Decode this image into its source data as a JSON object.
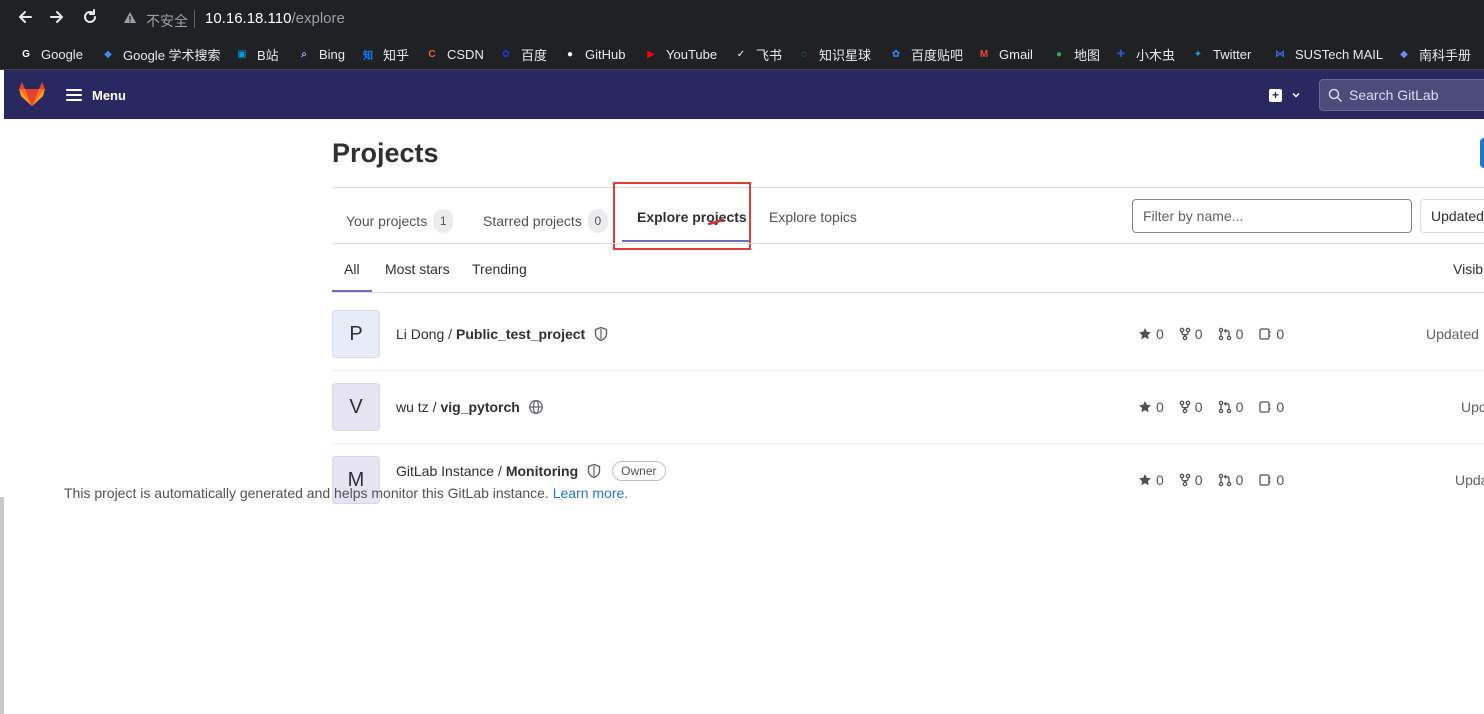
{
  "browser": {
    "security_warning": "不安全",
    "url_host": "10.16.18.110",
    "url_path": "/explore",
    "bookmarks": [
      {
        "label": "Google",
        "icon": "google-icon",
        "color": "#ffffff"
      },
      {
        "label": "Google 学术搜索",
        "icon": "google-scholar-icon",
        "color": "#4285f4"
      },
      {
        "label": "B站",
        "icon": "bilibili-icon",
        "color": "#00a1d6"
      },
      {
        "label": "Bing",
        "icon": "search-icon",
        "color": "#8ab4f8"
      },
      {
        "label": "知乎",
        "icon": "zhihu-icon",
        "color": "#0084ff"
      },
      {
        "label": "CSDN",
        "icon": "csdn-icon",
        "color": "#fc5531"
      },
      {
        "label": "百度",
        "icon": "baidu-icon",
        "color": "#2932e1"
      },
      {
        "label": "GitHub",
        "icon": "github-icon",
        "color": "#ffffff"
      },
      {
        "label": "YouTube",
        "icon": "youtube-icon",
        "color": "#ff0000"
      },
      {
        "label": "飞书",
        "icon": "feishu-icon",
        "color": "#ffffff"
      },
      {
        "label": "知识星球",
        "icon": "zsxq-icon",
        "color": "#16b998"
      },
      {
        "label": "百度贴吧",
        "icon": "tieba-icon",
        "color": "#3385ff"
      },
      {
        "label": "Gmail",
        "icon": "gmail-icon",
        "color": "#ea4335"
      },
      {
        "label": "地图",
        "icon": "maps-icon",
        "color": "#34a853"
      },
      {
        "label": "小木虫",
        "icon": "xmc-icon",
        "color": "#1a5bc4"
      },
      {
        "label": "Twitter",
        "icon": "twitter-icon",
        "color": "#1d9bf0"
      },
      {
        "label": "SUSTech MAIL",
        "icon": "sustech-mail-icon",
        "color": "#3b6fd8"
      },
      {
        "label": "南科手册",
        "icon": "handbook-icon",
        "color": "#6b8cff"
      }
    ]
  },
  "header": {
    "menu_label": "Menu",
    "search_placeholder": "Search GitLab",
    "brand_color": "#292961"
  },
  "page": {
    "title": "Projects",
    "tabs": [
      {
        "label": "Your projects",
        "count": "1"
      },
      {
        "label": "Starred projects",
        "count": "0"
      },
      {
        "label": "Explore projects",
        "count": ""
      },
      {
        "label": "Explore topics",
        "count": ""
      }
    ],
    "filter_placeholder": "Filter by name...",
    "sort_label": "Updated",
    "subtabs": [
      "All",
      "Most stars",
      "Trending"
    ],
    "visibility_label": "Visib"
  },
  "projects": [
    {
      "avatar": "P",
      "namespace": "Li Dong /",
      "name": "Public_test_project",
      "visibility_icon": "shield-icon",
      "badge": "",
      "description": "",
      "stars": "0",
      "forks": "0",
      "merge_requests": "0",
      "issues": "0",
      "updated": "Updated"
    },
    {
      "avatar": "V",
      "namespace": "wu tz /",
      "name": "vig_pytorch",
      "visibility_icon": "globe-icon",
      "badge": "",
      "description": "",
      "stars": "0",
      "forks": "0",
      "merge_requests": "0",
      "issues": "0",
      "updated": "Upd"
    },
    {
      "avatar": "M",
      "namespace": "GitLab Instance /",
      "name": "Monitoring",
      "visibility_icon": "shield-icon",
      "badge": "Owner",
      "description": "This project is automatically generated and helps monitor this GitLab instance.",
      "description_link": "Learn more.",
      "stars": "0",
      "forks": "0",
      "merge_requests": "0",
      "issues": "0",
      "updated": "Upda"
    }
  ]
}
